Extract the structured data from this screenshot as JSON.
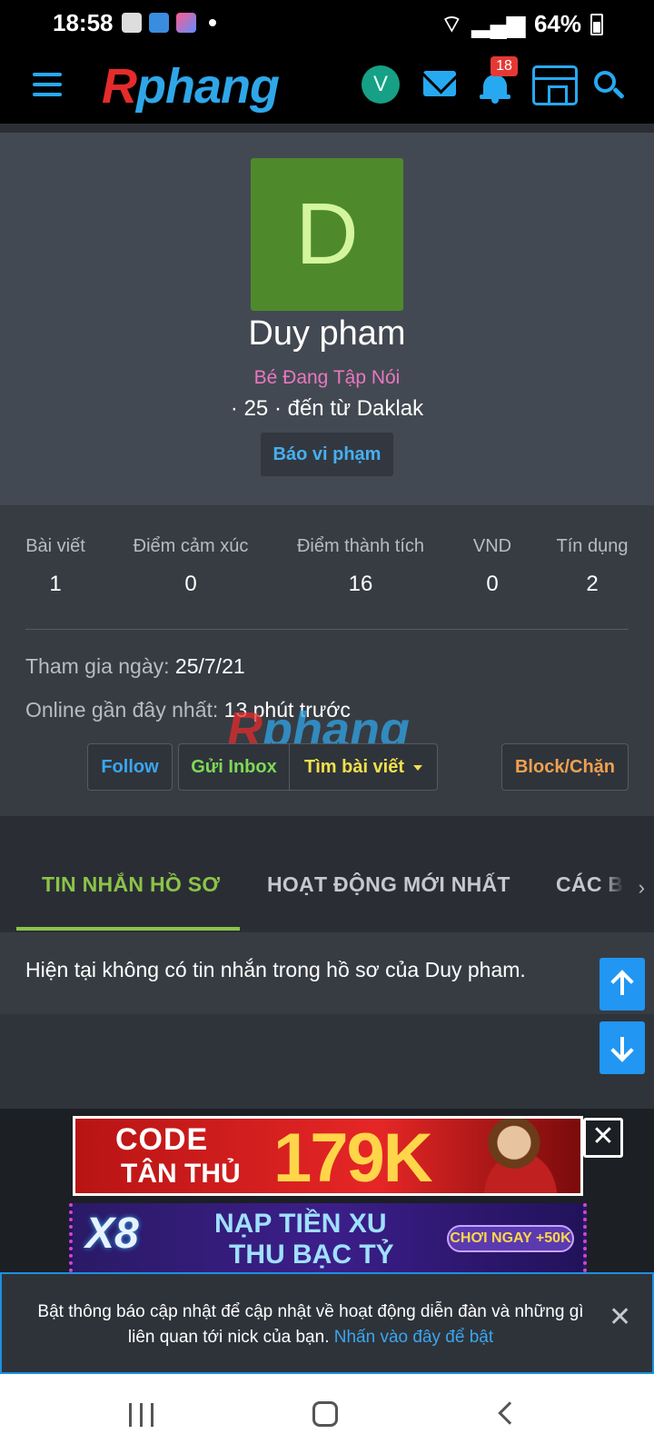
{
  "status_bar": {
    "time": "18:58",
    "battery": "64%"
  },
  "header": {
    "logo_first": "R",
    "logo_rest": "phang",
    "avatar_initial": "V",
    "notification_count": "18"
  },
  "profile": {
    "avatar_initial": "D",
    "name": "Duy pham",
    "title": "Bé Đang Tập Nói",
    "meta": "· 25 · đến từ Daklak",
    "report_label": "Báo vi phạm"
  },
  "stats": [
    {
      "label": "Bài viết",
      "value": "1"
    },
    {
      "label": "Điểm cảm xúc",
      "value": "0"
    },
    {
      "label": "Điểm thành tích",
      "value": "16"
    },
    {
      "label": "VND",
      "value": "0"
    },
    {
      "label": "Tín dụng",
      "value": "2"
    }
  ],
  "info": {
    "joined_label": "Tham gia ngày:",
    "joined_value": "25/7/21",
    "online_label": "Online gần đây nhất:",
    "online_value": "13 phút trước"
  },
  "actions": {
    "follow": "Follow",
    "inbox": "Gửi Inbox",
    "find_posts": "Tìm bài viết",
    "block": "Block/Chặn"
  },
  "tabs": [
    {
      "label": "TIN NHẮN HỒ SƠ",
      "active": true
    },
    {
      "label": "HOẠT ĐỘNG MỚI NHẤT",
      "active": false
    },
    {
      "label": "CÁC B",
      "active": false
    }
  ],
  "messages": {
    "empty_text": "Hiện tại không có tin nhắn trong hồ sơ của Duy pham."
  },
  "ads": {
    "ad1_code": "CODE",
    "ad1_sub": "TÂN THỦ",
    "ad1_amount": "179K",
    "ad2_brand": "X8",
    "ad2_line1": "NẠP TIỀN XU",
    "ad2_line2": "THU BẠC TỶ",
    "ad2_cta": "CHƠI NGAY +50K"
  },
  "notice": {
    "text": "Bật thông báo cập nhật để cập nhật về hoạt động diễn đàn và những gì liên quan tới nick của bạn.",
    "link": "Nhấn vào đây để bật"
  },
  "colors": {
    "accent_blue": "#27a9f1",
    "tab_active": "#8bc34a",
    "title_pink": "#e977c2",
    "inbox_green": "#7ed957",
    "find_yellow": "#f1e04b",
    "block_orange": "#f0a050",
    "logo_red": "#e52b2b"
  }
}
